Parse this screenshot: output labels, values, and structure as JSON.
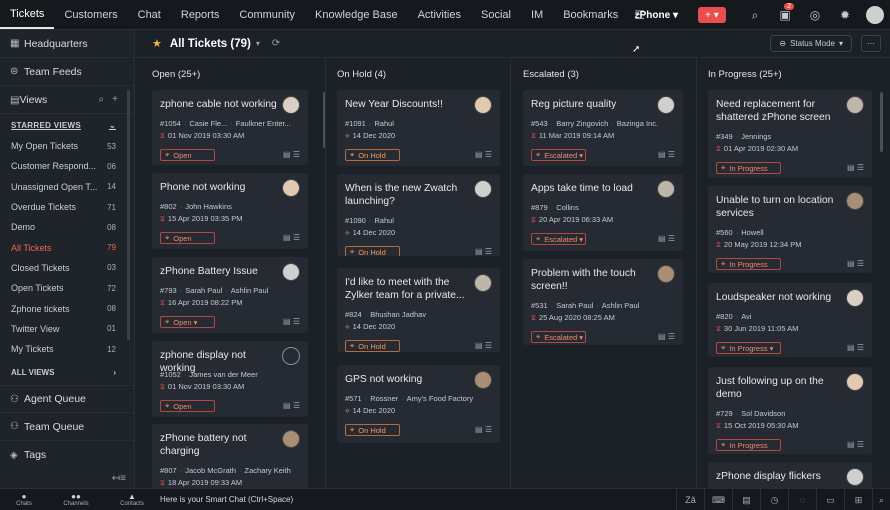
{
  "topnav": {
    "tabs": [
      "Tickets",
      "Customers",
      "Chat",
      "Reports",
      "Community",
      "Knowledge Base",
      "Activities",
      "Social",
      "IM",
      "Bookmarks"
    ],
    "department": "zPhone ▾",
    "add_label": "+ ▾",
    "notification_count": "2"
  },
  "sidebar": {
    "headquarters": "Headquarters",
    "team_feeds": "Team Feeds",
    "views": "Views",
    "starred_header": "STARRED VIEWS",
    "starred_views": [
      {
        "label": "My Open Tickets",
        "count": "53"
      },
      {
        "label": "Customer Respond...",
        "count": "06"
      },
      {
        "label": "Unassigned Open T...",
        "count": "14"
      },
      {
        "label": "Overdue Tickets",
        "count": "71"
      },
      {
        "label": "Demo",
        "count": "08"
      },
      {
        "label": "All Tickets",
        "count": "79"
      },
      {
        "label": "Closed Tickets",
        "count": "03"
      },
      {
        "label": "Open Tickets",
        "count": "72"
      },
      {
        "label": "Zphone tickets",
        "count": "08"
      },
      {
        "label": "Twitter View",
        "count": "01"
      },
      {
        "label": "My Tickets",
        "count": "12"
      }
    ],
    "all_views": "ALL VIEWS",
    "agent_queue": "Agent Queue",
    "team_queue": "Team Queue",
    "tags": "Tags"
  },
  "header": {
    "title": "All Tickets (79)",
    "status_mode": "Status Mode",
    "more": "···"
  },
  "columns": [
    {
      "title": "Open (25+)",
      "cards": [
        {
          "title": "zphone cable not working",
          "id": "#1054",
          "contact": "Casie Fle...",
          "account": "Faulkner Enter...",
          "date": "01 Nov 2019 03:30 AM",
          "status": "Open"
        },
        {
          "title": "Phone not working",
          "id": "#802",
          "contact": "John Hawkins",
          "account": "",
          "date": "15 Apr 2019 03:35 PM",
          "status": "Open"
        },
        {
          "title": "zPhone Battery Issue",
          "id": "#793",
          "contact": "Sarah Paul",
          "account": "Ashlin Paul",
          "date": "16 Apr 2019 08:22 PM",
          "status": "Open ▾"
        },
        {
          "title": "zphone display not working",
          "id": "#1052",
          "contact": "James van der Meer",
          "account": "",
          "date": "01 Nov 2019 03:30 AM",
          "status": "Open"
        },
        {
          "title": "zPhone battery not charging",
          "id": "#807",
          "contact": "Jacob McGrath",
          "account": "Zachary Keith",
          "date": "18 Apr 2019 09:33 AM",
          "status": ""
        }
      ]
    },
    {
      "title": "On Hold (4)",
      "cards": [
        {
          "title": "New Year Discounts!!",
          "id": "#1091",
          "contact": "Rahul",
          "account": "",
          "date": "14 Dec 2020",
          "status": "On Hold"
        },
        {
          "title": "When is the new Zwatch launching?",
          "id": "#1090",
          "contact": "Rahul",
          "account": "",
          "date": "14 Dec 2020",
          "status": "On Hold"
        },
        {
          "title": "I'd like to meet with the Zylker team for a private...",
          "id": "#824",
          "contact": "Bhushan Jadhav",
          "account": "",
          "date": "14 Dec 2020",
          "status": "On Hold"
        },
        {
          "title": "GPS not working",
          "id": "#571",
          "contact": "Rossner",
          "account": "Amy's Food Factory",
          "date": "14 Dec 2020",
          "status": "On Hold"
        }
      ]
    },
    {
      "title": "Escalated (3)",
      "cards": [
        {
          "title": "Reg picture quality",
          "id": "#543",
          "contact": "Barry Zingovich",
          "account": "Bazinga Inc.",
          "date": "11 Mar 2019 09:14 AM",
          "status": "Escalated ▾"
        },
        {
          "title": "Apps take time to load",
          "id": "#879",
          "contact": "Collins",
          "account": "",
          "date": "20 Apr 2019 06:33 AM",
          "status": "Escalated ▾"
        },
        {
          "title": "Problem with the touch screen!!",
          "id": "#531",
          "contact": "Sarah Paul",
          "account": "Ashlin Paul",
          "date": "25 Aug 2020 08:25 AM",
          "status": "Escalated ▾"
        }
      ]
    },
    {
      "title": "In Progress (25+)",
      "cards": [
        {
          "title": "Need replacement for shattered zPhone screen",
          "id": "#349",
          "contact": "Jennings",
          "account": "",
          "date": "01 Apr 2019 02:30 AM",
          "status": "In Progress"
        },
        {
          "title": "Unable to turn on location services",
          "id": "#560",
          "contact": "Howell",
          "account": "",
          "date": "20 May 2019 12:34 PM",
          "status": "In Progress"
        },
        {
          "title": "Loudspeaker not working",
          "id": "#820",
          "contact": "Avi",
          "account": "",
          "date": "30 Jun 2019 11:05 AM",
          "status": "In Progress ▾"
        },
        {
          "title": "Just following up on the demo",
          "id": "#729",
          "contact": "Sol Davidson",
          "account": "",
          "date": "15 Oct 2019 05:30 AM",
          "status": "In Progress"
        },
        {
          "title": "zPhone display flickers",
          "id": "",
          "contact": "",
          "account": "",
          "date": "",
          "status": ""
        }
      ]
    }
  ],
  "bottombar": {
    "chats": "Chats",
    "channels": "Channels",
    "contacts": "Contacts",
    "smartchat": "Here is your Smart Chat (Ctrl+Space)"
  }
}
